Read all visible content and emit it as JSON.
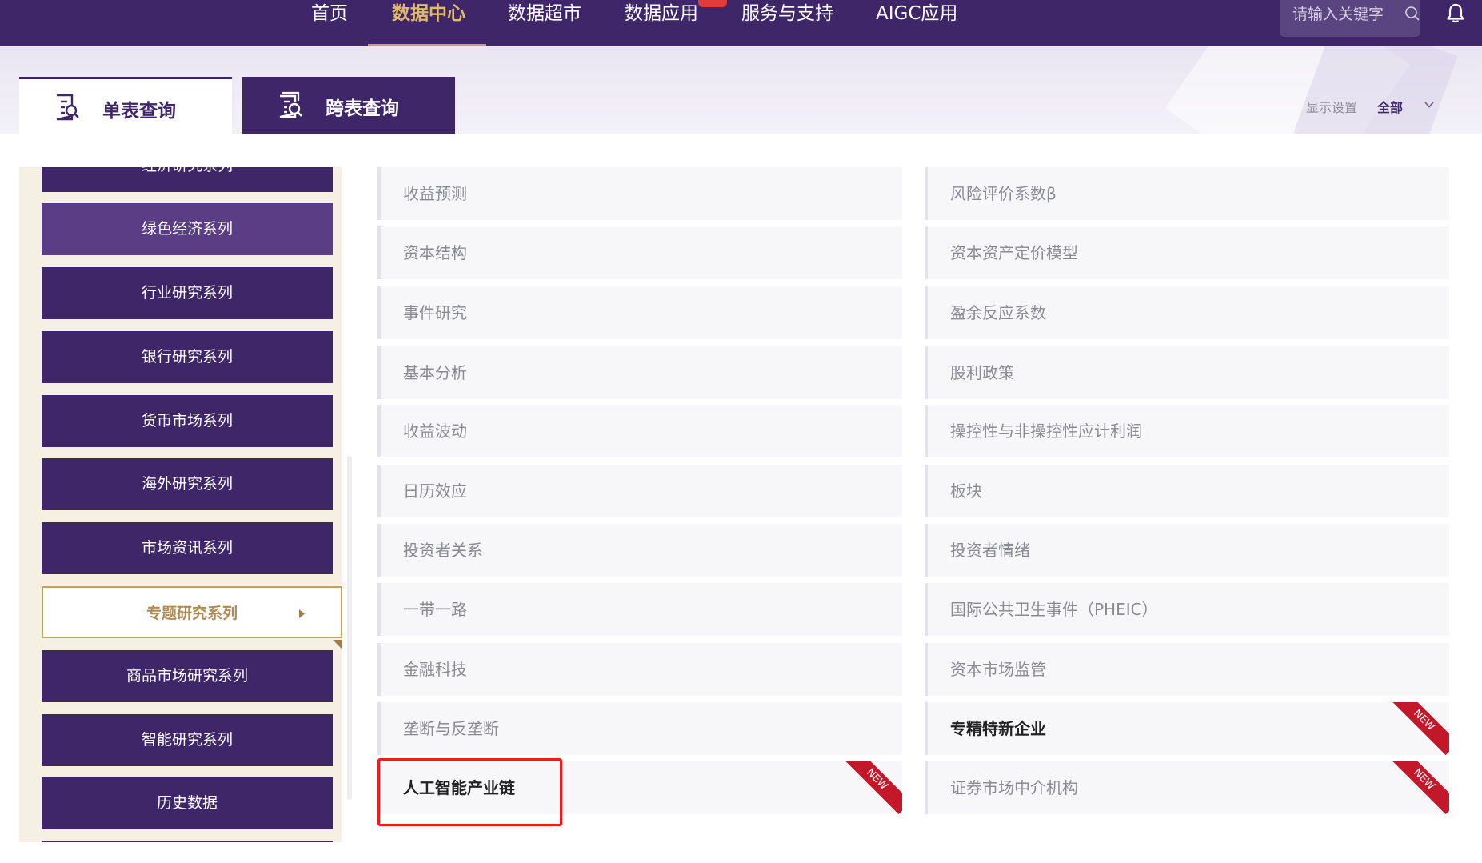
{
  "nav": {
    "items": [
      {
        "label": "首页"
      },
      {
        "label": "数据中心"
      },
      {
        "label": "数据超市"
      },
      {
        "label": "数据应用"
      },
      {
        "label": "服务与支持"
      },
      {
        "label": "AIGC应用"
      }
    ],
    "active": "数据中心",
    "search_placeholder": "请输入关键字"
  },
  "tabs": {
    "single": "单表查询",
    "cross": "跨表查询"
  },
  "display": {
    "label": "显示设置",
    "value": "全部"
  },
  "sidebar": {
    "items": [
      {
        "label": "经济研究系列"
      },
      {
        "label": "绿色经济系列"
      },
      {
        "label": "行业研究系列"
      },
      {
        "label": "银行研究系列"
      },
      {
        "label": "货币市场系列"
      },
      {
        "label": "海外研究系列"
      },
      {
        "label": "市场资讯系列"
      },
      {
        "label": "专题研究系列"
      },
      {
        "label": "商品市场研究系列"
      },
      {
        "label": "智能研究系列"
      },
      {
        "label": "历史数据"
      }
    ],
    "active": "专题研究系列"
  },
  "content": {
    "left": [
      {
        "label": "收益预测"
      },
      {
        "label": "资本结构"
      },
      {
        "label": "事件研究"
      },
      {
        "label": "基本分析"
      },
      {
        "label": "收益波动"
      },
      {
        "label": "日历效应"
      },
      {
        "label": "投资者关系"
      },
      {
        "label": "一带一路"
      },
      {
        "label": "金融科技"
      },
      {
        "label": "垄断与反垄断"
      },
      {
        "label": "人工智能产业链"
      }
    ],
    "right": [
      {
        "label": "风险评价系数β"
      },
      {
        "label": "资本资产定价模型"
      },
      {
        "label": "盈余反应系数"
      },
      {
        "label": "股利政策"
      },
      {
        "label": "操控性与非操控性应计利润"
      },
      {
        "label": "板块"
      },
      {
        "label": "投资者情绪"
      },
      {
        "label": "国际公共卫生事件（PHEIC）"
      },
      {
        "label": "资本市场监管"
      },
      {
        "label": "专精特新企业"
      },
      {
        "label": "证券市场中介机构"
      }
    ],
    "new_badge": "NEW"
  },
  "colors": {
    "brand": "#3f2668",
    "accent": "#c9a05a",
    "highlight": "#ee1c1c"
  }
}
